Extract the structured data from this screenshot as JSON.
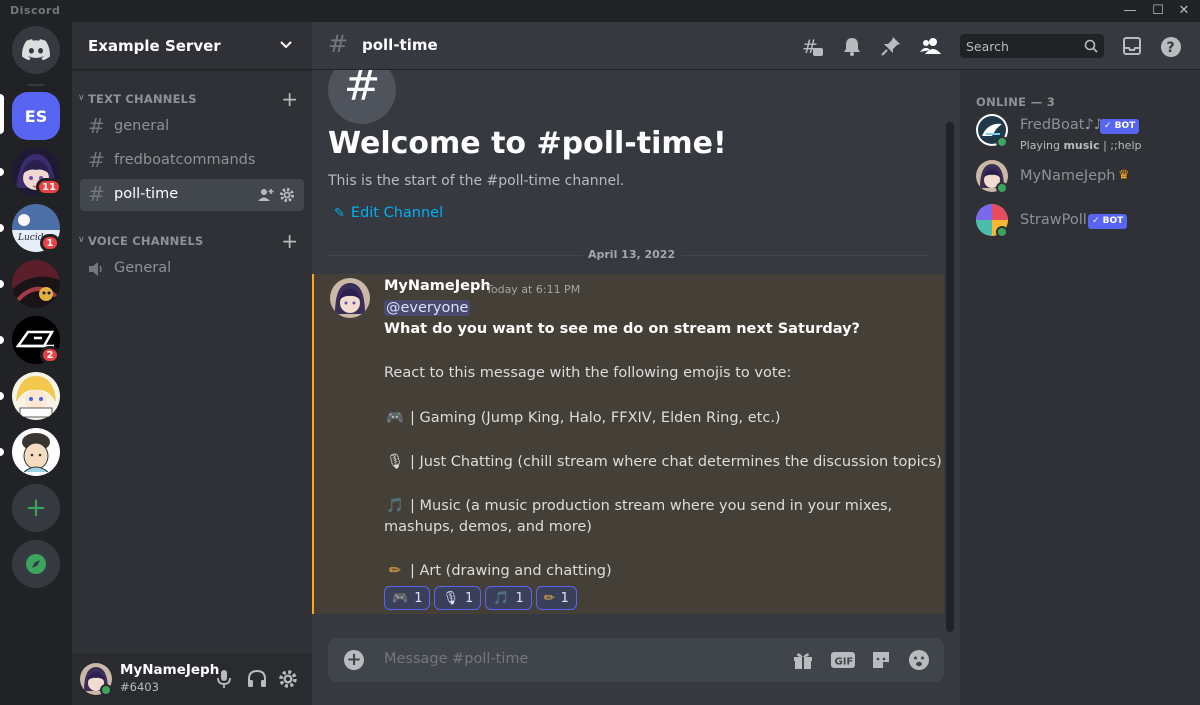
{
  "window": {
    "app_name": "Discord",
    "minimize": "—",
    "maximize": "☐",
    "close": "✕"
  },
  "servers": {
    "es_initials": "ES",
    "badges": [
      "11",
      "1",
      "2"
    ]
  },
  "sidebar": {
    "server_name": "Example Server",
    "text_category": "TEXT CHANNELS",
    "voice_category": "VOICE CHANNELS",
    "text_channels": [
      "general",
      "fredboatcommands",
      "poll-time"
    ],
    "voice_channels": [
      "General"
    ]
  },
  "user": {
    "name": "MyNameJeph",
    "tag": "#6403"
  },
  "header": {
    "channel": "poll-time",
    "search_placeholder": "Search"
  },
  "welcome": {
    "title": "Welcome to #poll-time!",
    "subtitle": "This is the start of the #poll-time channel.",
    "edit_label": "Edit Channel"
  },
  "date_divider": "April 13, 2022",
  "message": {
    "author": "MyNameJeph",
    "timestamp": "Today at 6:11 PM",
    "mention": "@everyone",
    "question": "What do you want to see me do on stream next Saturday?",
    "instruction": "React to this message with the following emojis to vote:",
    "option_gaming": "| Gaming (Jump King, Halo, FFXIV, Elden Ring, etc.)",
    "option_chatting": "| Just Chatting (chill stream where chat determines the discussion topics)",
    "option_music_1": "| Music (a music production stream where you send in your mixes,",
    "option_music_2": "mashups, demos, and more)",
    "option_art": "| Art (drawing and chatting)",
    "emoji_gaming": "🎮",
    "emoji_chatting": "🎙",
    "emoji_music": "🎵",
    "emoji_art": "✏",
    "reaction_counts": [
      "1",
      "1",
      "1",
      "1"
    ]
  },
  "composer": {
    "placeholder": "Message #poll-time"
  },
  "members": {
    "header": "ONLINE — 3",
    "list": [
      {
        "name": "FredBoat♪♪",
        "activity_prefix": "Playing ",
        "activity_game": "music",
        "activity_suffix": " | ;;help",
        "badge": "✓ BOT"
      },
      {
        "name": "MyNameJeph",
        "crown": "♛"
      },
      {
        "name": "StrawPoll",
        "badge": "✓ BOT"
      }
    ]
  },
  "colors": {
    "accent": "#5865f2",
    "online": "#3ba55d",
    "mention_bar": "#faa81a",
    "link": "#00aff4"
  }
}
